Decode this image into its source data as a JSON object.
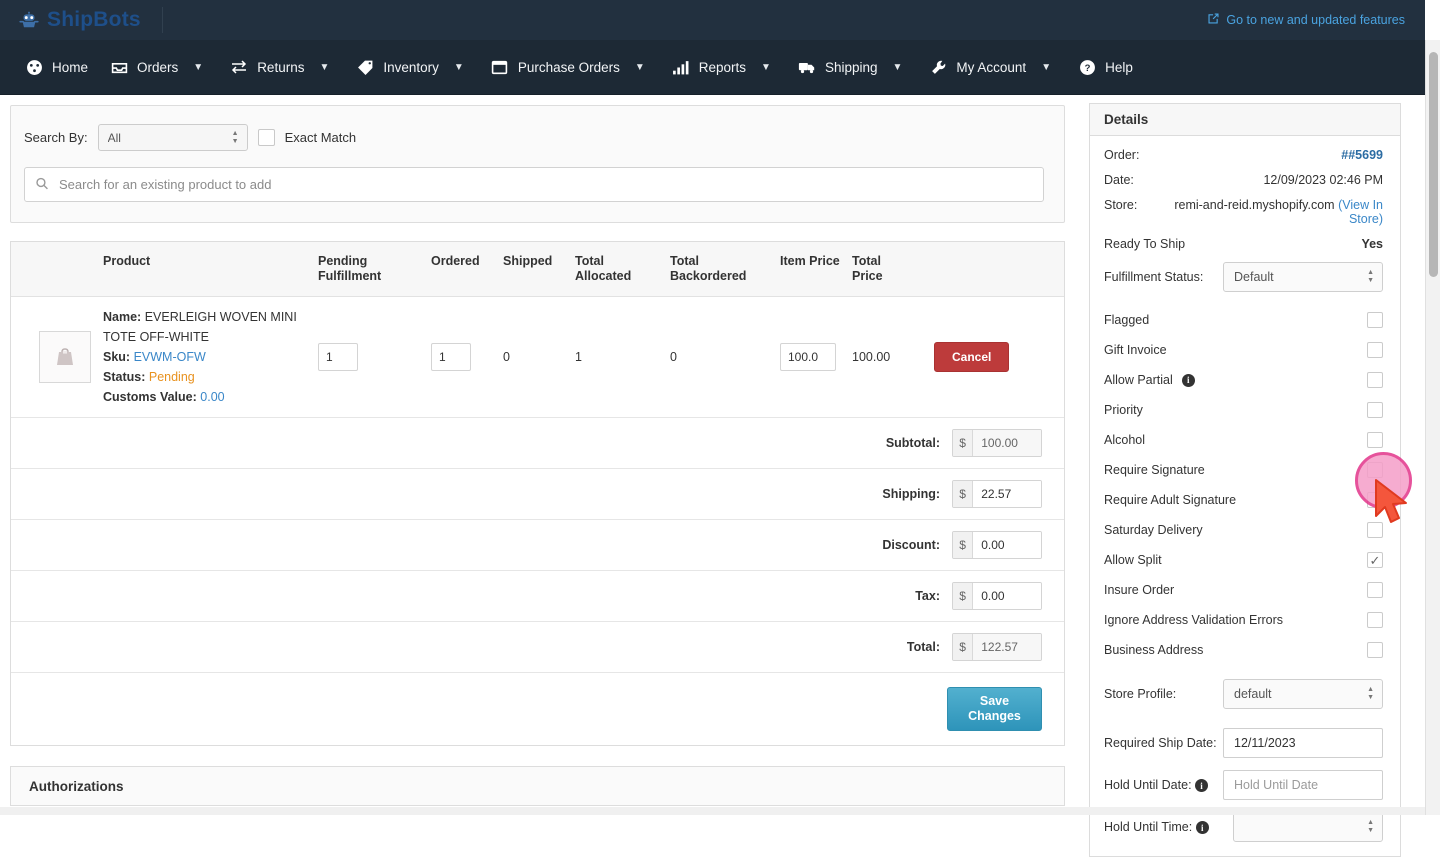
{
  "topbar": {
    "brand": "ShipBots",
    "brand_icon": "robot-logo-icon",
    "features_link": "Go to new and updated features",
    "features_icon": "external-link-icon"
  },
  "nav": {
    "items": [
      {
        "label": "Home",
        "icon": "dashboard-icon",
        "caret": false
      },
      {
        "label": "Orders",
        "icon": "inbox-icon",
        "caret": true
      },
      {
        "label": "Returns",
        "icon": "exchange-arrows-icon",
        "caret": true
      },
      {
        "label": "Inventory",
        "icon": "tag-icon",
        "caret": true
      },
      {
        "label": "Purchase Orders",
        "icon": "box-icon",
        "caret": true
      },
      {
        "label": "Reports",
        "icon": "bar-chart-icon",
        "caret": true
      },
      {
        "label": "Shipping",
        "icon": "truck-icon",
        "caret": true
      },
      {
        "label": "My Account",
        "icon": "wrench-icon",
        "caret": true
      },
      {
        "label": "Help",
        "icon": "question-circle-icon",
        "caret": false
      }
    ]
  },
  "search": {
    "search_by_label": "Search By:",
    "search_by_value": "All",
    "exact_match_label": "Exact Match",
    "exact_match_checked": false,
    "placeholder": "Search for an existing product to add",
    "value": "",
    "search_icon": "search-icon"
  },
  "items_table": {
    "headers": [
      "",
      "Product",
      "Pending Fulfillment",
      "Ordered",
      "Shipped",
      "Total Allocated",
      "Total Backordered",
      "Item Price",
      "Total Price",
      ""
    ],
    "rows": [
      {
        "thumb_alt": "product-thumbnail",
        "name_label": "Name:",
        "name_value": "EVERLEIGH WOVEN MINI TOTE OFF-WHITE",
        "sku_label": "Sku:",
        "sku_value": "EVWM-OFW",
        "status_label": "Status:",
        "status_value": "Pending",
        "customs_label": "Customs Value:",
        "customs_value": "0.00",
        "pending_fulfillment": "1",
        "ordered": "1",
        "shipped": "0",
        "total_allocated": "1",
        "total_backordered": "0",
        "item_price": "100.0",
        "total_price": "100.00",
        "action_label": "Cancel"
      }
    ],
    "totals": [
      {
        "label": "Subtotal:",
        "symbol": "$",
        "value": "100.00",
        "readonly": true
      },
      {
        "label": "Shipping:",
        "symbol": "$",
        "value": "22.57",
        "readonly": false
      },
      {
        "label": "Discount:",
        "symbol": "$",
        "value": "0.00",
        "readonly": false
      },
      {
        "label": "Tax:",
        "symbol": "$",
        "value": "0.00",
        "readonly": false
      },
      {
        "label": "Total:",
        "symbol": "$",
        "value": "122.57",
        "readonly": true
      }
    ],
    "save_label": "Save Changes"
  },
  "authorizations": {
    "title": "Authorizations"
  },
  "details": {
    "title": "Details",
    "order_label": "Order:",
    "order_value": "##5699",
    "date_label": "Date:",
    "date_value": "12/09/2023 02:46 PM",
    "store_label": "Store:",
    "store_value": "remi-and-reid.myshopify.com",
    "store_link": "(View In Store)",
    "ready_label": "Ready To Ship",
    "ready_value": "Yes",
    "fulfillment_label": "Fulfillment Status:",
    "fulfillment_value": "Default",
    "checkboxes": [
      {
        "label": "Flagged",
        "checked": false,
        "info": false
      },
      {
        "label": "Gift Invoice",
        "checked": false,
        "info": false
      },
      {
        "label": "Allow Partial",
        "checked": false,
        "info": true
      },
      {
        "label": "Priority",
        "checked": false,
        "info": false
      },
      {
        "label": "Alcohol",
        "checked": false,
        "info": false
      },
      {
        "label": "Require Signature",
        "checked": false,
        "info": false
      },
      {
        "label": "Require Adult Signature",
        "checked": false,
        "info": false
      },
      {
        "label": "Saturday Delivery",
        "checked": false,
        "info": false
      },
      {
        "label": "Allow Split",
        "checked": true,
        "info": false
      },
      {
        "label": "Insure Order",
        "checked": false,
        "info": false
      },
      {
        "label": "Ignore Address Validation Errors",
        "checked": false,
        "info": false
      },
      {
        "label": "Business Address",
        "checked": false,
        "info": false
      }
    ],
    "store_profile_label": "Store Profile:",
    "store_profile_value": "default",
    "required_ship_date_label": "Required Ship Date:",
    "required_ship_date_value": "12/11/2023",
    "hold_until_date_label": "Hold Until Date:",
    "hold_until_date_placeholder": "Hold Until Date",
    "hold_until_date_value": "",
    "hold_until_time_label": "Hold Until Time:",
    "check_glyph": "✓"
  },
  "colors": {
    "topbar_bg": "#22303f",
    "nav_bg": "#1d2935",
    "brand_blue": "#1e4f8a",
    "link_blue": "#3a87c8",
    "cancel_red": "#bd3b3b",
    "save_teal": "#2e94ba",
    "pending_orange": "#e8921f",
    "highlight_pink": "#e2348a"
  }
}
